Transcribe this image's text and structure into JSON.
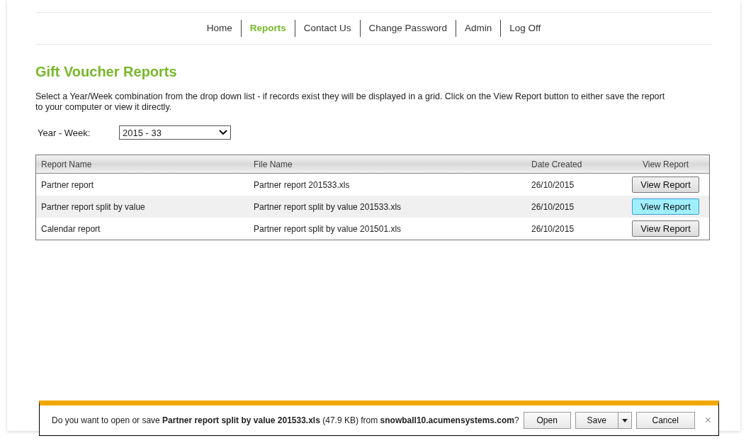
{
  "nav": [
    {
      "label": "Home",
      "selected": false
    },
    {
      "label": "Reports",
      "selected": true
    },
    {
      "label": "Contact Us",
      "selected": false
    },
    {
      "label": "Change Password",
      "selected": false
    },
    {
      "label": "Admin",
      "selected": false
    },
    {
      "label": "Log Off",
      "selected": false
    }
  ],
  "title": "Gift Voucher Reports",
  "description": "Select a Year/Week combination from the drop down list - if records exist they will be displayed in a grid. Click on the View Report button to either save the report to your computer or view it directly.",
  "filter": {
    "label": "Year - Week:",
    "value": "2015 - 33"
  },
  "table": {
    "columns": [
      "Report Name",
      "File Name",
      "Date Created",
      "View Report"
    ],
    "rows": [
      {
        "report_name": "Partner report",
        "file_name": "Partner report 201533.xls",
        "date_created": "26/10/2015",
        "button": "View Report",
        "highlighted": false
      },
      {
        "report_name": "Partner report split by value",
        "file_name": "Partner report split by value 201533.xls",
        "date_created": "26/10/2015",
        "button": "View Report",
        "highlighted": true
      },
      {
        "report_name": "Calendar report",
        "file_name": "Partner report split by value 201501.xls",
        "date_created": "26/10/2015",
        "button": "View Report",
        "highlighted": false
      }
    ]
  },
  "download_bar": {
    "message": "Do you want to open or save **Partner report split by value 201533.xls** (47.9 KB) from **snowball10.acumensystems.com**?",
    "buttons": [
      "Open",
      "Save",
      "Cancel"
    ],
    "close": "×"
  }
}
